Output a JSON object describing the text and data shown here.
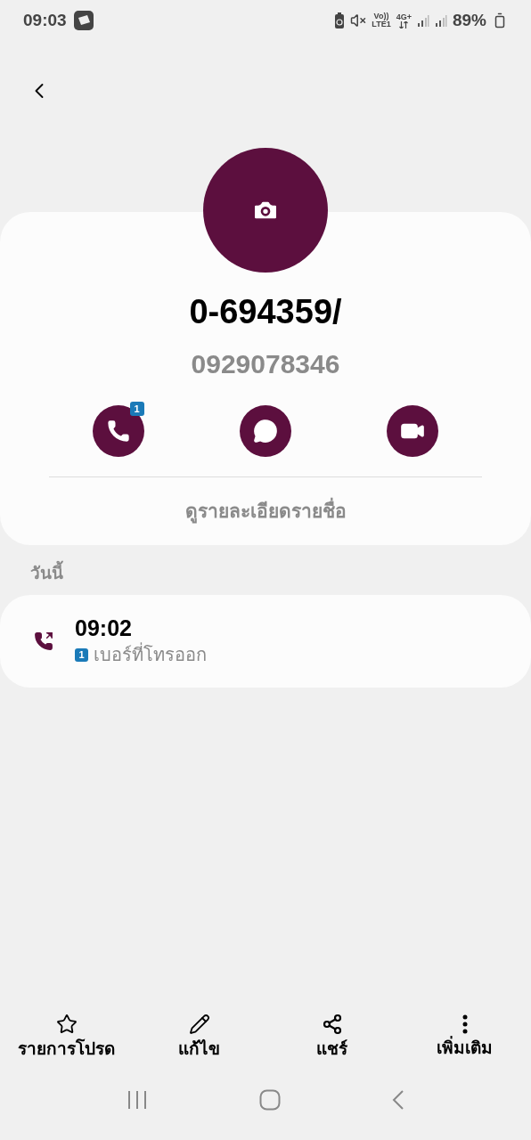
{
  "status_bar": {
    "time": "09:03",
    "volte": "Vo))",
    "sim": "LTE1",
    "network": "4G+",
    "battery": "89%"
  },
  "contact": {
    "name": "0-694359/",
    "number": "0929078346"
  },
  "actions": [
    {
      "kind": "call",
      "badge": "1"
    },
    {
      "kind": "message"
    },
    {
      "kind": "video"
    }
  ],
  "details_link": "ดูรายละเอียดรายชื่อ",
  "log_section": "วันนี้",
  "call_log": [
    {
      "time": "09:02",
      "sim": "1",
      "type": "เบอร์ที่โทรออก"
    }
  ],
  "bottom_actions": [
    {
      "kind": "favorite",
      "label": "รายการโปรด"
    },
    {
      "kind": "edit",
      "label": "แก้ไข"
    },
    {
      "kind": "share",
      "label": "แชร์"
    },
    {
      "kind": "more",
      "label": "เพิ่มเติม"
    }
  ]
}
